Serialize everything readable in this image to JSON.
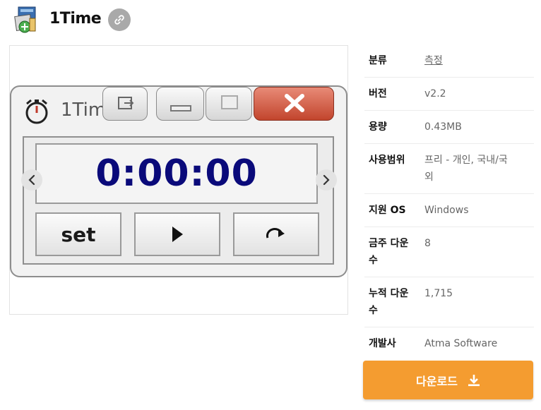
{
  "header": {
    "app_name": "1Time",
    "icon": "installer-package-icon",
    "link_icon": "link-icon"
  },
  "screenshot": {
    "window_title": "1Time",
    "timer_display": "0:00:00",
    "set_label": "set",
    "play_icon": "play-icon",
    "reset_icon": "redo-icon",
    "prev_icon": "chevron-left-icon",
    "next_icon": "chevron-right-icon"
  },
  "info": {
    "rows": [
      {
        "label": "분류",
        "value": "측정"
      },
      {
        "label": "버전",
        "value": "v2.2"
      },
      {
        "label": "용량",
        "value": "0.43MB"
      },
      {
        "label": "사용범위",
        "value_line1": "프리 - 개인, 국내/국",
        "value_line2": "외"
      },
      {
        "label": "지원 OS",
        "value": "Windows"
      },
      {
        "label_line1": "금주 다운",
        "label_line2": "수",
        "value": "8"
      },
      {
        "label_line1": "누적 다운",
        "label_line2": "수",
        "value": "1,715"
      },
      {
        "label": "개발사",
        "value": "Atma Software"
      }
    ]
  },
  "download": {
    "label": "다운로드",
    "icon": "download-icon",
    "color": "#f49c30"
  }
}
